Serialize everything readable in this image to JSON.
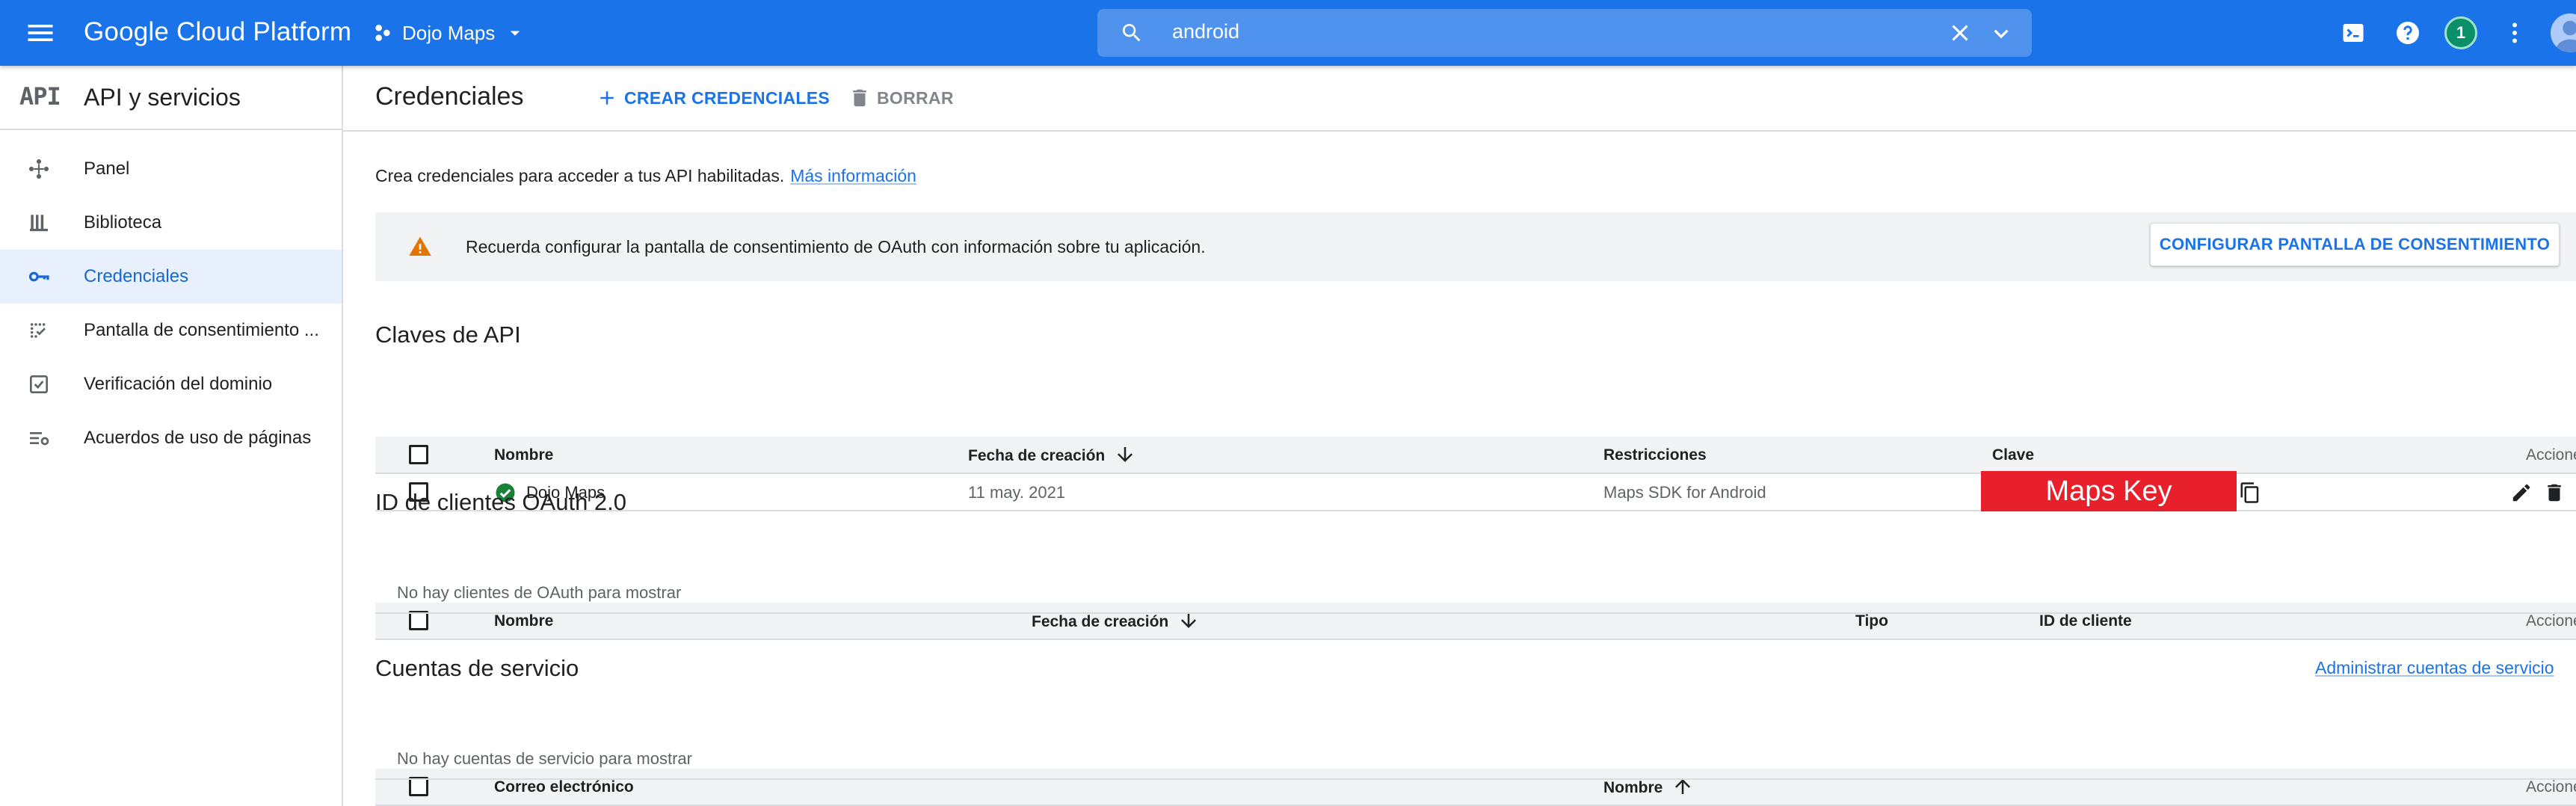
{
  "topbar": {
    "brand": "Google Cloud Platform",
    "project": "Dojo Maps",
    "search_value": "android",
    "notification_count": "1",
    "colors": {
      "bar": "#1a73e8"
    }
  },
  "sidebar": {
    "logo": "API",
    "title": "API y servicios",
    "items": [
      {
        "label": "Panel",
        "icon": "dashboard-icon"
      },
      {
        "label": "Biblioteca",
        "icon": "library-icon"
      },
      {
        "label": "Credenciales",
        "icon": "key-icon",
        "active": true
      },
      {
        "label": "Pantalla de consentimiento ...",
        "icon": "consent-icon"
      },
      {
        "label": "Verificación del dominio",
        "icon": "checkbox-icon"
      },
      {
        "label": "Acuerdos de uso de páginas",
        "icon": "settings-list-icon"
      }
    ]
  },
  "main": {
    "title": "Credenciales",
    "create_label": "CREAR CREDENCIALES",
    "delete_label": "BORRAR",
    "intro_text": "Crea credenciales para acceder a tus API habilitadas.",
    "intro_link": "Más información",
    "banner_text": "Recuerda configurar la pantalla de consentimiento de OAuth con información sobre tu aplicación.",
    "banner_button": "CONFIGURAR PANTALLA DE CONSENTIMIENTO"
  },
  "api_keys": {
    "title": "Claves de API",
    "columns": {
      "name": "Nombre",
      "created": "Fecha de creación",
      "restrictions": "Restricciones",
      "key": "Clave",
      "actions": "Acciones"
    },
    "rows": [
      {
        "name": "Dojo Maps",
        "created": "11 may. 2021",
        "restrictions": "Maps SDK for Android",
        "key": "Maps Key"
      }
    ]
  },
  "oauth": {
    "title": "ID de clientes OAuth 2.0",
    "columns": {
      "name": "Nombre",
      "created": "Fecha de creación",
      "type": "Tipo",
      "client_id": "ID de cliente",
      "actions": "Acciones"
    },
    "empty": "No hay clientes de OAuth para mostrar"
  },
  "service_accounts": {
    "title": "Cuentas de servicio",
    "manage_link": "Administrar cuentas de servicio",
    "columns": {
      "email": "Correo electrónico",
      "name": "Nombre",
      "actions": "Acciones"
    },
    "empty": "No hay cuentas de servicio para mostrar"
  }
}
